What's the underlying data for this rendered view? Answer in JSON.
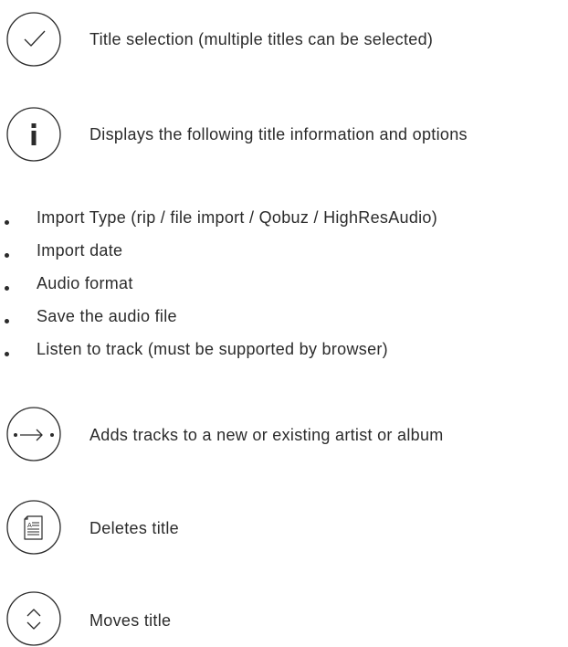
{
  "items": [
    {
      "icon": "checkmark-icon",
      "text": "Title selection (multiple titles can be selected)"
    },
    {
      "icon": "info-icon",
      "text": "Displays the following title information and options"
    },
    {
      "icon": "arrow-connect-icon",
      "text": "Adds tracks to a new or existing artist or album"
    },
    {
      "icon": "document-icon",
      "text": "Deletes title"
    },
    {
      "icon": "move-updown-icon",
      "text": "Moves title"
    }
  ],
  "info_options": [
    "Import Type (rip / file import / Qobuz / HighResAudio)",
    "Import date",
    "Audio format",
    "Save the audio file",
    "Listen to track (must be supported by browser)"
  ]
}
